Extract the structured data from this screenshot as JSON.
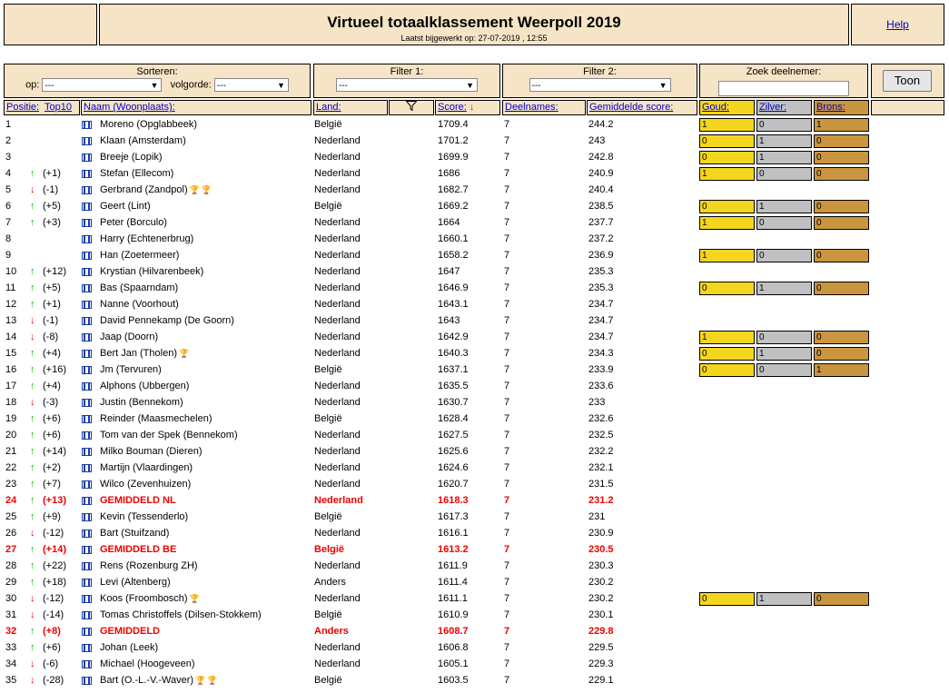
{
  "header": {
    "title": "Virtueel totaalklassement Weerpoll 2019",
    "updated": "Laatst bijgewerkt op: 27-07-2019 , 12:55",
    "help": "Help"
  },
  "controls": {
    "sort_label": "Sorteren:",
    "op_label": "op:",
    "op_value": "---",
    "order_label": "volgorde:",
    "order_value": "---",
    "filter1_label": "Filter 1:",
    "filter1_value": "---",
    "filter2_label": "Filter 2:",
    "filter2_value": "---",
    "search_label": "Zoek deelnemer:",
    "search_value": "",
    "toon": "Toon"
  },
  "columns": {
    "positie": "Positie:",
    "top10": "Top10",
    "naam": "Naam (Woonplaats):",
    "land": "Land:",
    "filter_icon": "funnel-icon",
    "score": "Score:",
    "deelnames": "Deelnames:",
    "gemiddelde": "Gemiddelde score:",
    "goud": "Goud:",
    "zilver": "Zilver:",
    "brons": "Brons:"
  },
  "colors": {
    "gold": "#f5d61e",
    "silver": "#c0c0c0",
    "bronze": "#c9953f",
    "header_bg": "#f6e4c6",
    "highlight": "#ee0000",
    "up": "#00bb00"
  },
  "rows": [
    {
      "pos": "1",
      "arrow": "",
      "trend": "",
      "name": "Moreno (Opglabbeek)",
      "land": "België",
      "score": "1709.4",
      "deel": "7",
      "avg": "244.2",
      "medals": [
        "1",
        "0",
        "1"
      ]
    },
    {
      "pos": "2",
      "arrow": "",
      "trend": "",
      "name": "Klaan (Amsterdam)",
      "land": "Nederland",
      "score": "1701.2",
      "deel": "7",
      "avg": "243",
      "medals": [
        "0",
        "1",
        "0"
      ]
    },
    {
      "pos": "3",
      "arrow": "",
      "trend": "",
      "name": "Breeje (Lopik)",
      "land": "Nederland",
      "score": "1699.9",
      "deel": "7",
      "avg": "242.8",
      "medals": [
        "0",
        "1",
        "0"
      ]
    },
    {
      "pos": "4",
      "arrow": "up",
      "trend": "(+1)",
      "name": "Stefan (Ellecom)",
      "land": "Nederland",
      "score": "1686",
      "deel": "7",
      "avg": "240.9",
      "medals": [
        "1",
        "0",
        "0"
      ]
    },
    {
      "pos": "5",
      "arrow": "down",
      "trend": "(-1)",
      "name": "Gerbrand (Zandpol)",
      "trophies": "bb",
      "land": "Nederland",
      "score": "1682.7",
      "deel": "7",
      "avg": "240.4"
    },
    {
      "pos": "6",
      "arrow": "up",
      "trend": "(+5)",
      "name": "Geert (Lint)",
      "land": "België",
      "score": "1669.2",
      "deel": "7",
      "avg": "238.5",
      "medals": [
        "0",
        "1",
        "0"
      ]
    },
    {
      "pos": "7",
      "arrow": "up",
      "trend": "(+3)",
      "name": "Peter (Borculo)",
      "land": "Nederland",
      "score": "1664",
      "deel": "7",
      "avg": "237.7",
      "medals": [
        "1",
        "0",
        "0"
      ]
    },
    {
      "pos": "8",
      "arrow": "",
      "trend": "",
      "name": "Harry (Echtenerbrug)",
      "land": "Nederland",
      "score": "1660.1",
      "deel": "7",
      "avg": "237.2"
    },
    {
      "pos": "9",
      "arrow": "",
      "trend": "",
      "name": "Han (Zoetermeer)",
      "land": "Nederland",
      "score": "1658.2",
      "deel": "7",
      "avg": "236.9",
      "medals": [
        "1",
        "0",
        "0"
      ]
    },
    {
      "pos": "10",
      "arrow": "up",
      "trend": "(+12)",
      "name": "Krystian (Hilvarenbeek)",
      "land": "Nederland",
      "score": "1647",
      "deel": "7",
      "avg": "235.3"
    },
    {
      "pos": "11",
      "arrow": "up",
      "trend": "(+5)",
      "name": "Bas (Spaarndam)",
      "land": "Nederland",
      "score": "1646.9",
      "deel": "7",
      "avg": "235.3",
      "medals": [
        "0",
        "1",
        "0"
      ]
    },
    {
      "pos": "12",
      "arrow": "up",
      "trend": "(+1)",
      "name": "Nanne (Voorhout)",
      "land": "Nederland",
      "score": "1643.1",
      "deel": "7",
      "avg": "234.7"
    },
    {
      "pos": "13",
      "arrow": "down",
      "trend": "(-1)",
      "name": "David Pennekamp (De Goorn)",
      "land": "Nederland",
      "score": "1643",
      "deel": "7",
      "avg": "234.7"
    },
    {
      "pos": "14",
      "arrow": "down",
      "trend": "(-8)",
      "name": "Jaap (Doorn)",
      "land": "Nederland",
      "score": "1642.9",
      "deel": "7",
      "avg": "234.7",
      "medals": [
        "1",
        "0",
        "0"
      ]
    },
    {
      "pos": "15",
      "arrow": "up",
      "trend": "(+4)",
      "name": "Bert Jan (Tholen)",
      "trophies": "b",
      "land": "Nederland",
      "score": "1640.3",
      "deel": "7",
      "avg": "234.3",
      "medals": [
        "0",
        "1",
        "0"
      ]
    },
    {
      "pos": "16",
      "arrow": "up",
      "trend": "(+16)",
      "name": "Jm (Tervuren)",
      "land": "België",
      "score": "1637.1",
      "deel": "7",
      "avg": "233.9",
      "medals": [
        "0",
        "0",
        "1"
      ]
    },
    {
      "pos": "17",
      "arrow": "up",
      "trend": "(+4)",
      "name": "Alphons (Ubbergen)",
      "land": "Nederland",
      "score": "1635.5",
      "deel": "7",
      "avg": "233.6"
    },
    {
      "pos": "18",
      "arrow": "down",
      "trend": "(-3)",
      "name": "Justin (Bennekom)",
      "land": "Nederland",
      "score": "1630.7",
      "deel": "7",
      "avg": "233"
    },
    {
      "pos": "19",
      "arrow": "up",
      "trend": "(+6)",
      "name": "Reinder (Maasmechelen)",
      "land": "België",
      "score": "1628.4",
      "deel": "7",
      "avg": "232.6"
    },
    {
      "pos": "20",
      "arrow": "up",
      "trend": "(+6)",
      "name": "Tom van der Spek (Bennekom)",
      "land": "Nederland",
      "score": "1627.5",
      "deel": "7",
      "avg": "232.5"
    },
    {
      "pos": "21",
      "arrow": "up",
      "trend": "(+14)",
      "name": "Milko Bouman (Dieren)",
      "land": "Nederland",
      "score": "1625.6",
      "deel": "7",
      "avg": "232.2"
    },
    {
      "pos": "22",
      "arrow": "up",
      "trend": "(+2)",
      "name": "Martijn (Vlaardingen)",
      "land": "Nederland",
      "score": "1624.6",
      "deel": "7",
      "avg": "232.1"
    },
    {
      "pos": "23",
      "arrow": "up",
      "trend": "(+7)",
      "name": "Wilco (Zevenhuizen)",
      "land": "Nederland",
      "score": "1620.7",
      "deel": "7",
      "avg": "231.5"
    },
    {
      "pos": "24",
      "arrow": "up",
      "trend": "(+13)",
      "name": "GEMIDDELD NL",
      "land": "Nederland",
      "score": "1618.3",
      "deel": "7",
      "avg": "231.2",
      "hl": true
    },
    {
      "pos": "25",
      "arrow": "up",
      "trend": "(+9)",
      "name": "Kevin (Tessenderlo)",
      "land": "België",
      "score": "1617.3",
      "deel": "7",
      "avg": "231"
    },
    {
      "pos": "26",
      "arrow": "down",
      "trend": "(-12)",
      "name": "Bart (Stuifzand)",
      "land": "Nederland",
      "score": "1616.1",
      "deel": "7",
      "avg": "230.9"
    },
    {
      "pos": "27",
      "arrow": "up",
      "trend": "(+14)",
      "name": "GEMIDDELD BE",
      "land": "België",
      "score": "1613.2",
      "deel": "7",
      "avg": "230.5",
      "hl": true
    },
    {
      "pos": "28",
      "arrow": "up",
      "trend": "(+22)",
      "name": "Rens (Rozenburg ZH)",
      "land": "Nederland",
      "score": "1611.9",
      "deel": "7",
      "avg": "230.3"
    },
    {
      "pos": "29",
      "arrow": "up",
      "trend": "(+18)",
      "name": "Levi (Altenberg)",
      "land": "Anders",
      "score": "1611.4",
      "deel": "7",
      "avg": "230.2"
    },
    {
      "pos": "30",
      "arrow": "down",
      "trend": "(-12)",
      "name": "Koos (Froombosch)",
      "trophies": "g",
      "land": "Nederland",
      "score": "1611.1",
      "deel": "7",
      "avg": "230.2",
      "medals": [
        "0",
        "1",
        "0"
      ]
    },
    {
      "pos": "31",
      "arrow": "down",
      "trend": "(-14)",
      "name": "Tomas Christoffels (Dilsen-Stokkem)",
      "land": "België",
      "score": "1610.9",
      "deel": "7",
      "avg": "230.1"
    },
    {
      "pos": "32",
      "arrow": "up",
      "trend": "(+8)",
      "name": "GEMIDDELD",
      "land": "Anders",
      "score": "1608.7",
      "deel": "7",
      "avg": "229.8",
      "hl": true
    },
    {
      "pos": "33",
      "arrow": "up",
      "trend": "(+6)",
      "name": "Johan (Leek)",
      "land": "Nederland",
      "score": "1606.8",
      "deel": "7",
      "avg": "229.5"
    },
    {
      "pos": "34",
      "arrow": "down",
      "trend": "(-6)",
      "name": "Michael (Hoogeveen)",
      "land": "Nederland",
      "score": "1605.1",
      "deel": "7",
      "avg": "229.3"
    },
    {
      "pos": "35",
      "arrow": "down",
      "trend": "(-28)",
      "name": "Bart (O.-L.-V.-Waver)",
      "trophies": "gg",
      "land": "België",
      "score": "1603.5",
      "deel": "7",
      "avg": "229.1"
    }
  ]
}
